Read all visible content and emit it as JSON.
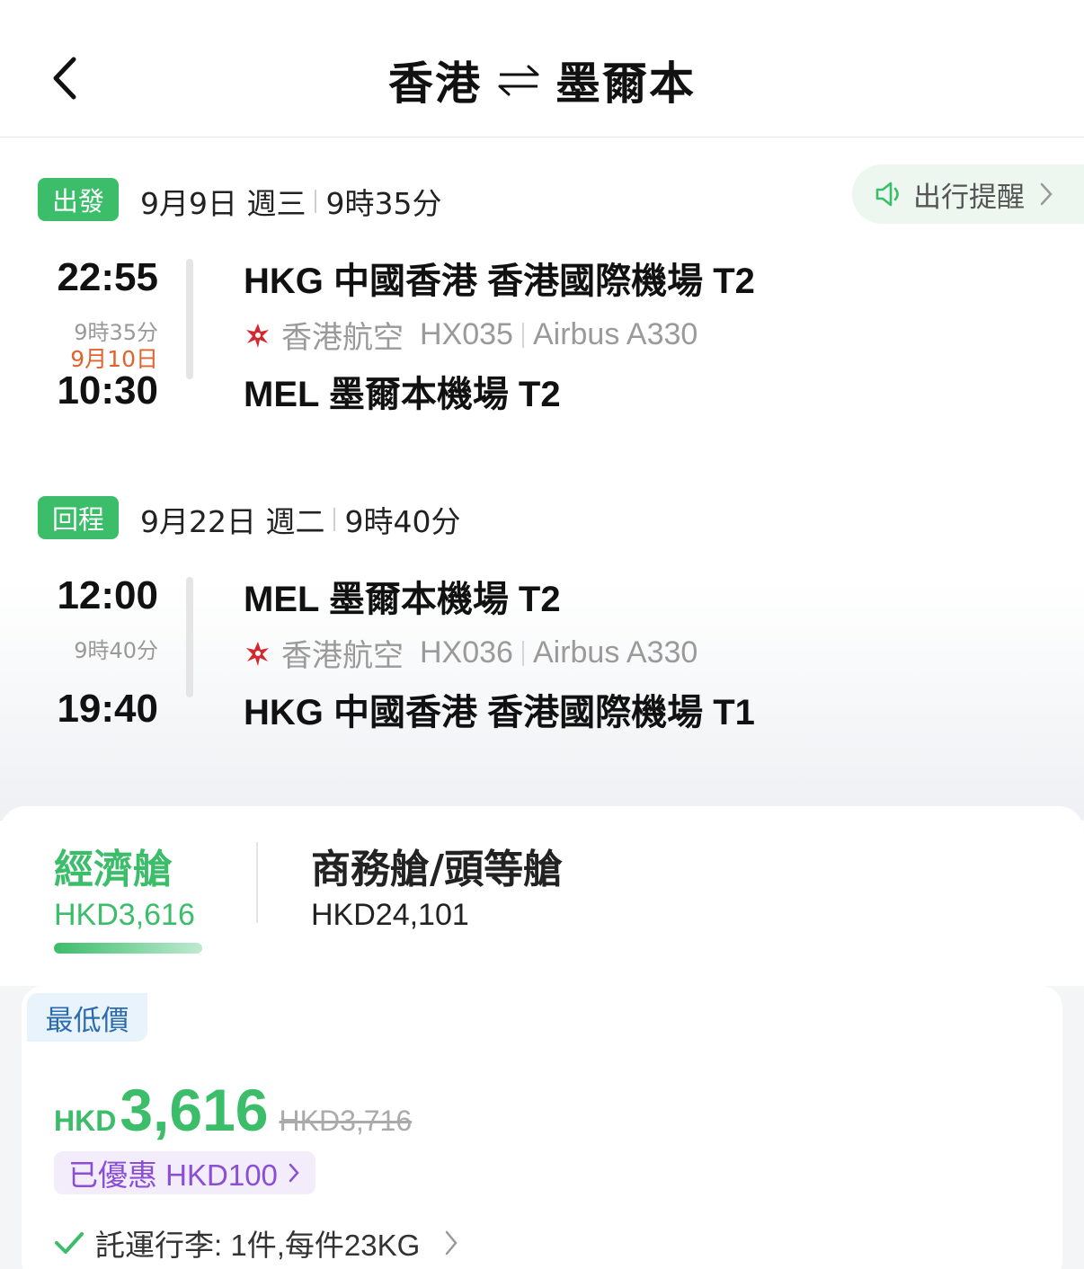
{
  "header": {
    "origin": "香港",
    "destination": "墨爾本"
  },
  "reminder": {
    "label": "出行提醒"
  },
  "outbound": {
    "badge": "出發",
    "date": "9月9日 週三",
    "duration_total": "9時35分",
    "depart_time": "22:55",
    "duration": "9時35分",
    "arrival_date": "9月10日",
    "arrive_time": "10:30",
    "depart_airport": "HKG 中國香港 香港國際機場 T2",
    "airline": "香港航空",
    "flight_no": "HX035",
    "aircraft": "Airbus A330",
    "arrive_airport": "MEL 墨爾本機場 T2"
  },
  "return": {
    "badge": "回程",
    "date": "9月22日 週二",
    "duration_total": "9時40分",
    "depart_time": "12:00",
    "duration": "9時40分",
    "arrive_time": "19:40",
    "depart_airport": "MEL 墨爾本機場 T2",
    "airline": "香港航空",
    "flight_no": "HX036",
    "aircraft": "Airbus A330",
    "arrive_airport": "HKG 中國香港 香港國際機場 T1"
  },
  "cabins": [
    {
      "name": "經濟艙",
      "price": "HKD3,616",
      "active": true
    },
    {
      "name": "商務艙/頭等艙",
      "price": "HKD24,101",
      "active": false
    }
  ],
  "fare": {
    "badge": "最低價",
    "currency": "HKD",
    "amount": "3,616",
    "original": "HKD3,716",
    "discount": "已優惠 HKD100",
    "baggage": "託運行李: 1件,每件23KG"
  },
  "colors": {
    "accent_green": "#3bbd6a",
    "next_day_orange": "#e2622c",
    "discount_purple": "#8a4fd6",
    "badge_blue": "#2c6bb0"
  }
}
